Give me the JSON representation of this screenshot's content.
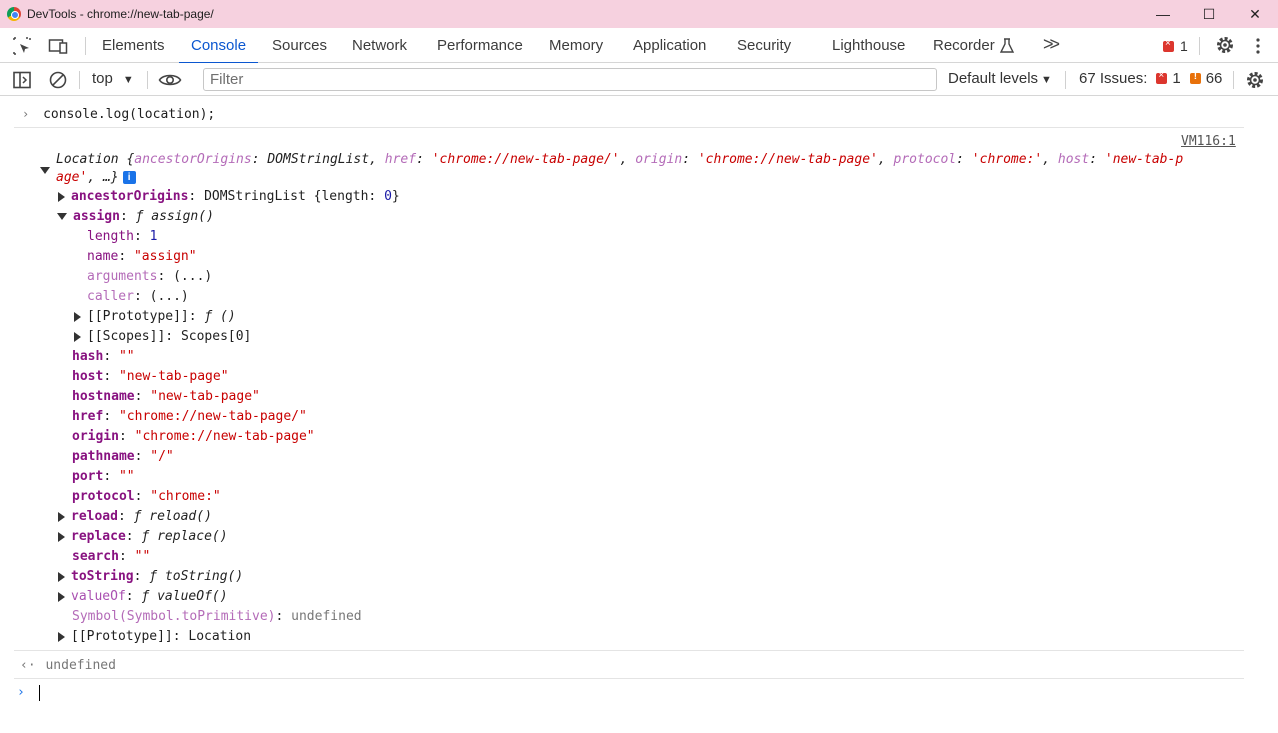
{
  "window": {
    "title": "DevTools - chrome://new-tab-page/",
    "controls": [
      "—",
      "☐",
      "✕"
    ]
  },
  "tabs": [
    {
      "label": "Elements",
      "active": false
    },
    {
      "label": "Console",
      "active": true
    },
    {
      "label": "Sources",
      "active": false
    },
    {
      "label": "Network",
      "active": false
    },
    {
      "label": "Performance",
      "active": false
    },
    {
      "label": "Memory",
      "active": false
    },
    {
      "label": "Application",
      "active": false
    },
    {
      "label": "Security",
      "active": false
    },
    {
      "label": "Lighthouse",
      "active": false
    },
    {
      "label": "Recorder",
      "active": false
    }
  ],
  "tabbar": {
    "more_tabs": ">>",
    "error_count": "1"
  },
  "toolbar": {
    "context": "top",
    "filter_placeholder": "Filter",
    "levels": "Default levels",
    "issues_label": "67 Issues:",
    "issues_errors": "1",
    "issues_warnings": "66"
  },
  "console": {
    "input": "console.log(location);",
    "source_link": "VM116:1",
    "summary_line1": {
      "name": "Location",
      "open": " {",
      "k1": "ancestorOrigins",
      "v1": "DOMStringList",
      "k2": "href",
      "v2": "'chrome://new-tab-page/'",
      "k3": "origin",
      "v3": "'chrome://new-tab-page'",
      "k4": "protocol",
      "v4": "'chrome:'",
      "k5": "host",
      "v5": "'new-tab-p"
    },
    "summary_line2": {
      "v5_cont": "age'",
      "rest": ", …}"
    },
    "info_badge": "i",
    "props": {
      "ancestorOrigins_key": "ancestorOrigins",
      "ancestorOrigins_val": "DOMStringList {length: ",
      "ancestorOrigins_len": "0",
      "ancestorOrigins_close": "}",
      "assign_key": "assign",
      "assign_val": "ƒ assign()",
      "length_key": "length",
      "length_val": "1",
      "name_key": "name",
      "name_val": "\"assign\"",
      "arguments_key": "arguments",
      "arguments_val": "(...)",
      "caller_key": "caller",
      "caller_val": "(...)",
      "proto_fn_key": "[[Prototype]]",
      "proto_fn_val": "ƒ ()",
      "scopes_key": "[[Scopes]]",
      "scopes_val": "Scopes[0]",
      "hash_key": "hash",
      "hash_val": "\"\"",
      "host_key": "host",
      "host_val": "\"new-tab-page\"",
      "hostname_key": "hostname",
      "hostname_val": "\"new-tab-page\"",
      "href_key": "href",
      "href_val": "\"chrome://new-tab-page/\"",
      "origin_key": "origin",
      "origin_val": "\"chrome://new-tab-page\"",
      "pathname_key": "pathname",
      "pathname_val": "\"/\"",
      "port_key": "port",
      "port_val": "\"\"",
      "protocol_key": "protocol",
      "protocol_val": "\"chrome:\"",
      "reload_key": "reload",
      "reload_val": "ƒ reload()",
      "replace_key": "replace",
      "replace_val": "ƒ replace()",
      "search_key": "search",
      "search_val": "\"\"",
      "toString_key": "toString",
      "toString_val": "ƒ toString()",
      "valueOf_key": "valueOf",
      "valueOf_val": "ƒ valueOf()",
      "symbol_key": "Symbol(Symbol.toPrimitive)",
      "symbol_val": "undefined",
      "proto_key": "[[Prototype]]",
      "proto_val": "Location"
    },
    "result": "undefined"
  }
}
